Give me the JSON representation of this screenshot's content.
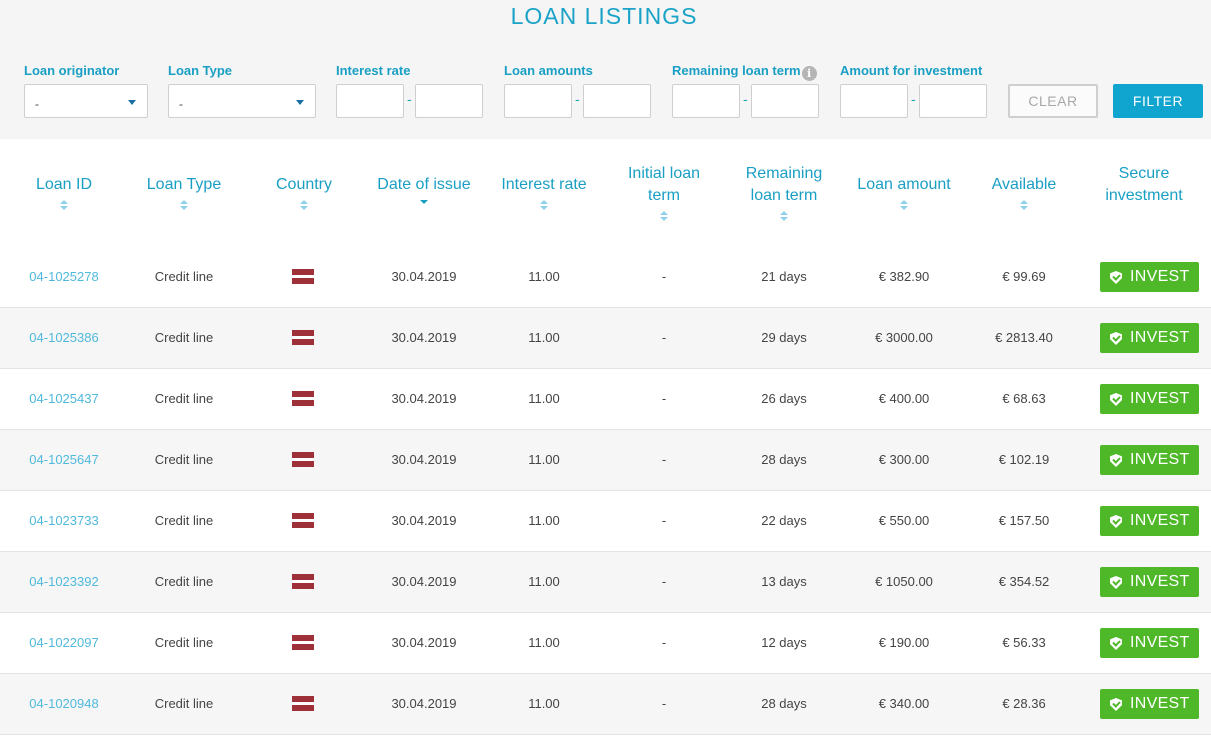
{
  "page_title": "LOAN LISTINGS",
  "filters": {
    "loan_originator": {
      "label": "Loan originator",
      "value": "-"
    },
    "loan_type": {
      "label": "Loan Type",
      "value": "-"
    },
    "interest_rate": {
      "label": "Interest rate",
      "separator": "-"
    },
    "loan_amounts": {
      "label": "Loan amounts",
      "separator": "-"
    },
    "remaining_term": {
      "label": "Remaining loan term",
      "info": "i",
      "separator": "-"
    },
    "amount_for_investment": {
      "label": "Amount for investment",
      "separator": "-"
    },
    "clear_label": "CLEAR",
    "filter_label": "FILTER"
  },
  "columns": {
    "loan_id": "Loan ID",
    "loan_type": "Loan Type",
    "country": "Country",
    "date_of_issue": "Date of issue",
    "interest_rate": "Interest rate",
    "initial_term_1": "Initial loan",
    "initial_term_2": "term",
    "remaining_term_1": "Remaining",
    "remaining_term_2": "loan term",
    "loan_amount": "Loan amount",
    "available": "Available",
    "secure_1": "Secure",
    "secure_2": "investment"
  },
  "rows": [
    {
      "id": "04-1025278",
      "type": "Credit line",
      "country": "latvia-flag",
      "date": "30.04.2019",
      "rate": "11.00",
      "initial": "-",
      "remaining": "21 days",
      "amount": "€ 382.90",
      "available": "€ 99.69",
      "action": "INVEST"
    },
    {
      "id": "04-1025386",
      "type": "Credit line",
      "country": "latvia-flag",
      "date": "30.04.2019",
      "rate": "11.00",
      "initial": "-",
      "remaining": "29 days",
      "amount": "€ 3000.00",
      "available": "€ 2813.40",
      "action": "INVEST"
    },
    {
      "id": "04-1025437",
      "type": "Credit line",
      "country": "latvia-flag",
      "date": "30.04.2019",
      "rate": "11.00",
      "initial": "-",
      "remaining": "26 days",
      "amount": "€ 400.00",
      "available": "€ 68.63",
      "action": "INVEST"
    },
    {
      "id": "04-1025647",
      "type": "Credit line",
      "country": "latvia-flag",
      "date": "30.04.2019",
      "rate": "11.00",
      "initial": "-",
      "remaining": "28 days",
      "amount": "€ 300.00",
      "available": "€ 102.19",
      "action": "INVEST"
    },
    {
      "id": "04-1023733",
      "type": "Credit line",
      "country": "latvia-flag",
      "date": "30.04.2019",
      "rate": "11.00",
      "initial": "-",
      "remaining": "22 days",
      "amount": "€ 550.00",
      "available": "€ 157.50",
      "action": "INVEST"
    },
    {
      "id": "04-1023392",
      "type": "Credit line",
      "country": "latvia-flag",
      "date": "30.04.2019",
      "rate": "11.00",
      "initial": "-",
      "remaining": "13 days",
      "amount": "€ 1050.00",
      "available": "€ 354.52",
      "action": "INVEST"
    },
    {
      "id": "04-1022097",
      "type": "Credit line",
      "country": "latvia-flag",
      "date": "30.04.2019",
      "rate": "11.00",
      "initial": "-",
      "remaining": "12 days",
      "amount": "€ 190.00",
      "available": "€ 56.33",
      "action": "INVEST"
    },
    {
      "id": "04-1020948",
      "type": "Credit line",
      "country": "latvia-flag",
      "date": "30.04.2019",
      "rate": "11.00",
      "initial": "-",
      "remaining": "28 days",
      "amount": "€ 340.00",
      "available": "€ 28.36",
      "action": "INVEST"
    }
  ],
  "colors": {
    "accent": "#1a9fc4",
    "link": "#4fb9dc",
    "invest": "#4fb829",
    "filter_button": "#10a5cf",
    "flag_red": "#9e3039"
  }
}
